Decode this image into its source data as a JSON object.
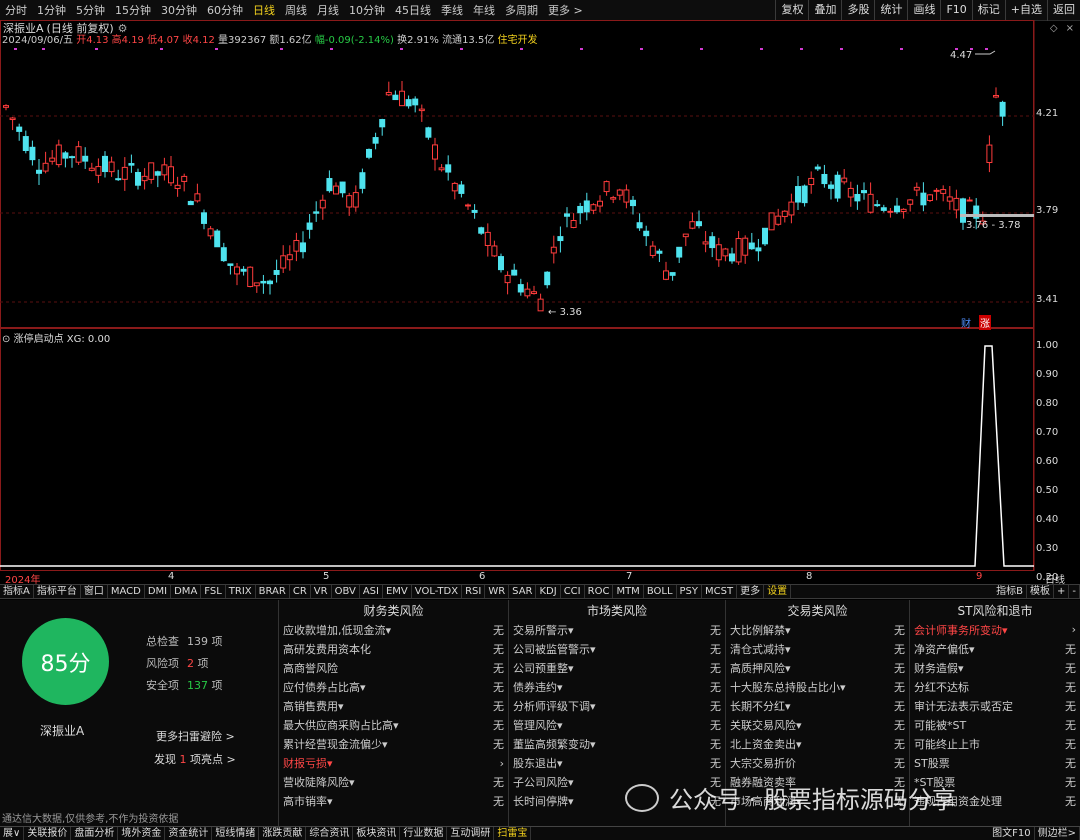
{
  "toolbar": {
    "periods": [
      "分时",
      "1分钟",
      "5分钟",
      "15分钟",
      "30分钟",
      "60分钟",
      "日线",
      "周线",
      "月线",
      "10分钟",
      "45日线",
      "季线",
      "年线",
      "多周期",
      "更多 >"
    ],
    "active_period": "日线",
    "tools": [
      "复权",
      "叠加",
      "多股",
      "统计",
      "画线",
      "F10",
      "标记",
      "+自选",
      "返回"
    ]
  },
  "stock": {
    "name": "深振业A",
    "mode": "(日线 前复权)",
    "date": "2024/09/06/五",
    "open_label": "开",
    "open": "4.13",
    "high_label": "高",
    "high": "4.19",
    "low_label": "低",
    "low": "4.07",
    "close_label": "收",
    "close": "4.12",
    "vol_label": "量",
    "volume": "392367",
    "amt_label": "额",
    "amount": "1.62亿",
    "chg_label": "幅",
    "change": "-0.09(-2.14%)",
    "turn_label": "换",
    "turnover": "2.91%",
    "float_label": "流通",
    "float": "13.5亿",
    "sector": "住宅开发"
  },
  "chart": {
    "max_label": "4.47",
    "min_label": "3.36",
    "range_label": "3.76 - 3.78",
    "price_levels": [
      "4.21",
      "3.79",
      "3.41"
    ],
    "badges": [
      "财",
      "涨"
    ],
    "indicator": {
      "name": "涨停启动点",
      "value_label": "XG: 0.00",
      "scale": [
        "1.00",
        "0.90",
        "0.80",
        "0.70",
        "0.60",
        "0.50",
        "0.40",
        "0.30",
        "0.20"
      ]
    },
    "x_labels": [
      "2024年",
      "4",
      "5",
      "6",
      "7",
      "8",
      "9"
    ],
    "x_corner": "日线"
  },
  "index_tabs": {
    "items": [
      "指标A",
      "指标平台",
      "窗口",
      "MACD",
      "DMI",
      "DMA",
      "FSL",
      "TRIX",
      "BRAR",
      "CR",
      "VR",
      "OBV",
      "ASI",
      "EMV",
      "VOL-TDX",
      "RSI",
      "WR",
      "SAR",
      "KDJ",
      "CCI",
      "ROC",
      "MTM",
      "BOLL",
      "PSY",
      "MCST",
      "更多",
      "设置"
    ],
    "active": "设置",
    "right": [
      "指标B",
      "模板",
      "+",
      "-"
    ]
  },
  "panel": {
    "score": "85分",
    "name": "深振业A",
    "stats": [
      {
        "label": "总检查",
        "value": "139",
        "unit": "项"
      },
      {
        "label": "风险项",
        "value": "2",
        "unit": "项"
      },
      {
        "label": "安全项",
        "value": "137",
        "unit": "项"
      }
    ],
    "more_link": "更多扫雷避险 >",
    "highlight_prefix": "发现",
    "highlight_count": "1",
    "highlight_suffix": "项亮点 >",
    "columns": [
      {
        "title": "财务类风险",
        "rows": [
          {
            "label": "应收款增加,低现金流▾",
            "value": "无"
          },
          {
            "label": "高研发费用资本化",
            "value": "无"
          },
          {
            "label": "高商誉风险",
            "value": "无"
          },
          {
            "label": "应付债券占比高▾",
            "value": "无"
          },
          {
            "label": "高销售费用▾",
            "value": "无"
          },
          {
            "label": "最大供应商采购占比高▾",
            "value": "无"
          },
          {
            "label": "累计经营现金流偏少▾",
            "value": "无"
          },
          {
            "label": "财报亏损▾",
            "value": "›",
            "risk": true
          },
          {
            "label": "营收陡降风险▾",
            "value": "无"
          },
          {
            "label": "高市销率▾",
            "value": "无"
          }
        ]
      },
      {
        "title": "市场类风险",
        "rows": [
          {
            "label": "交易所警示▾",
            "value": "无"
          },
          {
            "label": "公司被监管警示▾",
            "value": "无"
          },
          {
            "label": "公司预重整▾",
            "value": "无"
          },
          {
            "label": "债券违约▾",
            "value": "无"
          },
          {
            "label": "分析师评级下调▾",
            "value": "无"
          },
          {
            "label": "管理风险▾",
            "value": "无"
          },
          {
            "label": "董监高频繁变动▾",
            "value": "无"
          },
          {
            "label": "股东退出▾",
            "value": "无"
          },
          {
            "label": "子公司风险▾",
            "value": "无"
          },
          {
            "label": "长时间停牌▾",
            "value": "无"
          }
        ]
      },
      {
        "title": "交易类风险",
        "rows": [
          {
            "label": "大比例解禁▾",
            "value": "无"
          },
          {
            "label": "清仓式减持▾",
            "value": "无"
          },
          {
            "label": "高质押风险▾",
            "value": "无"
          },
          {
            "label": "十大股东总持股占比小▾",
            "value": "无"
          },
          {
            "label": "长期不分红▾",
            "value": "无"
          },
          {
            "label": "关联交易风险▾",
            "value": "无"
          },
          {
            "label": "北上资金卖出▾",
            "value": "无"
          },
          {
            "label": "大宗交易折价",
            "value": "无"
          },
          {
            "label": "融券融资卖率",
            "value": "无"
          },
          {
            "label": "市场高商利润▾",
            "value": "无"
          }
        ]
      },
      {
        "title": "ST风险和退市",
        "rows": [
          {
            "label": "会计师事务所变动▾",
            "value": "›",
            "risk": true
          },
          {
            "label": "净资产偏低▾",
            "value": "无"
          },
          {
            "label": "财务造假▾",
            "value": "无"
          },
          {
            "label": "分红不达标",
            "value": "无"
          },
          {
            "label": "审计无法表示或否定",
            "value": "无"
          },
          {
            "label": "可能被*ST",
            "value": "无"
          },
          {
            "label": "可能终止上市",
            "value": "无"
          },
          {
            "label": "ST股票",
            "value": "无"
          },
          {
            "label": "*ST股票",
            "value": "无"
          },
          {
            "label": "违规占用资金处理",
            "value": "无"
          }
        ]
      }
    ]
  },
  "watermark": "公众号 · 股票指标源码分享",
  "disclaimer": "通达信大数据,仅供参考,不作为投资依据",
  "bottom": {
    "items": [
      "展∨",
      "关联报价",
      "盘面分析",
      "境外资金",
      "资金统计",
      "短线情绪",
      "涨跌贡献",
      "综合资讯",
      "板块资讯",
      "行业数据",
      "互动调研",
      "扫雷宝"
    ],
    "active": "扫雷宝",
    "right": [
      "图文F10",
      "侧边栏>"
    ]
  },
  "colors": {
    "up": "#ff3c3c",
    "down": "#4fe3ee",
    "score_bg": "#1fb65f",
    "highlight": "#f2d11d"
  }
}
